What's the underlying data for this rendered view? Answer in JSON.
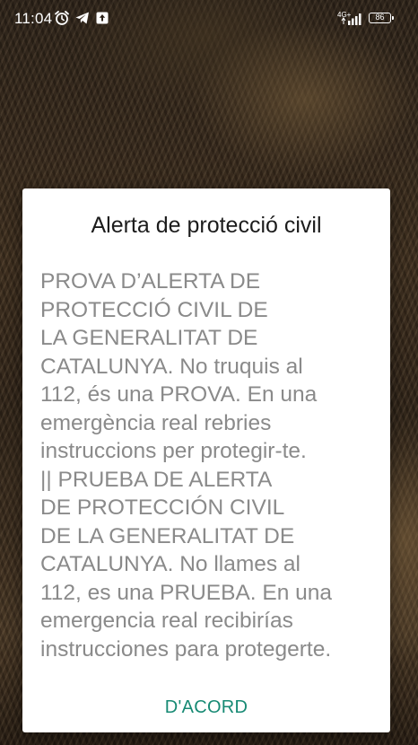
{
  "status_bar": {
    "time": "11:04",
    "icons": [
      "alarm-icon",
      "telegram-icon",
      "upload-icon"
    ],
    "network_label": "4G+",
    "battery_level": "86"
  },
  "alert_dialog": {
    "title": "Alerta de protecció civil",
    "message": "PROVA D’ALERTA DE\nPROTECCIÓ CIVIL DE\nLA GENERALITAT DE\nCATALUNYA. No truquis al\n112, és una PROVA. En una\nemergència real rebries\ninstruccions per protegir-te.\n|| PRUEBA DE ALERTA\nDE PROTECCIÓN CIVIL\nDE LA GENERALITAT DE\nCATALUNYA. No llames al\n112, es una PRUEBA. En una\nemergencia real recibirías\ninstrucciones para protegerte.",
    "button_label": "D'ACORD"
  },
  "colors": {
    "accent": "#178a74",
    "message_text": "#8a8a8a",
    "title_text": "#1c1c1c",
    "dialog_background": "#ffffff"
  }
}
